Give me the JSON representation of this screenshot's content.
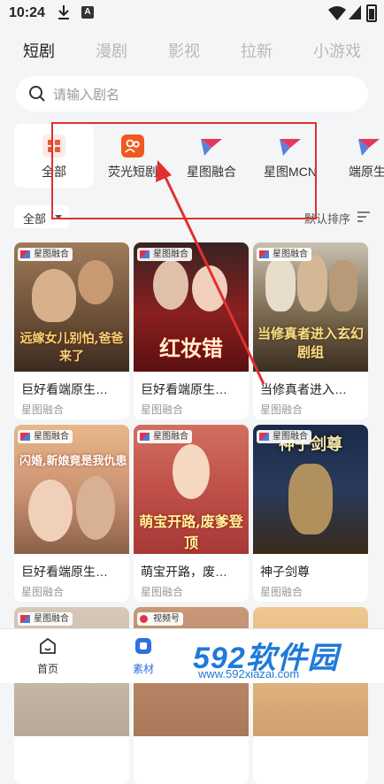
{
  "status_bar": {
    "time": "10:24"
  },
  "top_tabs": [
    {
      "label": "短剧",
      "active": true
    },
    {
      "label": "漫剧",
      "active": false
    },
    {
      "label": "影视",
      "active": false
    },
    {
      "label": "拉新",
      "active": false
    },
    {
      "label": "小游戏",
      "active": false
    }
  ],
  "search": {
    "placeholder": "请输入剧名"
  },
  "categories": [
    {
      "label": "全部",
      "icon": "grid-icon",
      "active": true
    },
    {
      "label": "荧光短剧",
      "icon": "people-icon",
      "active": false
    },
    {
      "label": "星图融合",
      "icon": "xingtu-logo-icon",
      "active": false
    },
    {
      "label": "星图MCN",
      "icon": "xingtu-logo-icon",
      "active": false
    },
    {
      "label": "端原生",
      "icon": "xingtu-logo-icon",
      "active": false
    }
  ],
  "filter": {
    "selected": "全部",
    "sort_label": "默认排序"
  },
  "cards": [
    {
      "badge": "星图融合",
      "title": "巨好看端原生…",
      "sub": "星图融合",
      "poster_text": "远嫁女儿别怕,爸爸来了"
    },
    {
      "badge": "星图融合",
      "title": "巨好看端原生…",
      "sub": "星图融合",
      "poster_text": "红妆错"
    },
    {
      "badge": "星图融合",
      "title": "当修真者进入…",
      "sub": "星图融合",
      "poster_text": "当修真者进入玄幻剧组"
    },
    {
      "badge": "星图融合",
      "title": "巨好看端原生…",
      "sub": "星图融合",
      "poster_text": "闪婚,新娘竟是我仇患"
    },
    {
      "badge": "星图融合",
      "title": "萌宝开路，废…",
      "sub": "星图融合",
      "poster_text": "萌宝开路,废爹登顶"
    },
    {
      "badge": "星图融合",
      "title": "神子剑尊",
      "sub": "星图融合",
      "poster_text": "神子剑尊"
    },
    {
      "badge": "星图融合",
      "title": "",
      "sub": "",
      "poster_text": ""
    },
    {
      "badge": "视频号",
      "title": "",
      "sub": "",
      "poster_text": ""
    },
    {
      "badge": "",
      "title": "",
      "sub": "",
      "poster_text": ""
    }
  ],
  "bottom_nav": [
    {
      "label": "首页",
      "icon": "home-icon",
      "active": false
    },
    {
      "label": "素材",
      "icon": "material-icon",
      "active": true
    }
  ],
  "watermark": {
    "logo": "592软件园",
    "url": "www.592xiazai.com"
  },
  "colors": {
    "accent": "#2f6fe0",
    "annotation": "#e0312f",
    "watermark": "#1f7ad8"
  }
}
